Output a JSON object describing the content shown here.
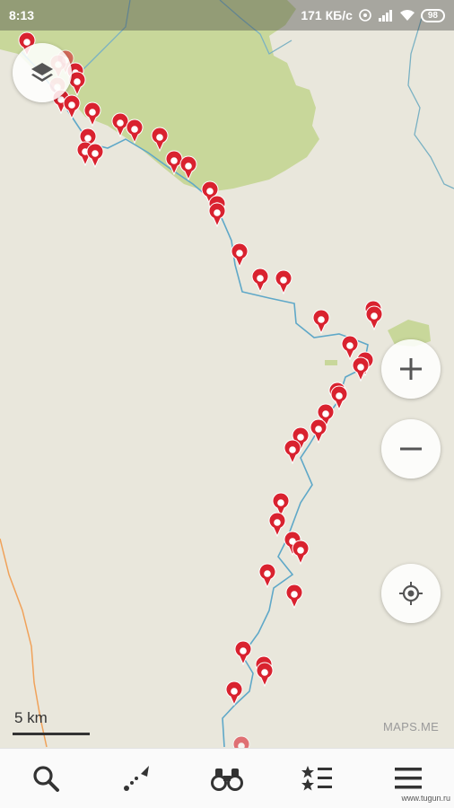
{
  "status_bar": {
    "time": "8:13",
    "network_speed": "171 КБ/с",
    "battery_level": "98",
    "icons": [
      "hotspot-icon",
      "signal-icon",
      "wifi-icon",
      "battery-icon"
    ]
  },
  "map": {
    "scale_label": "5 km",
    "brand_label": "MAPS.ME",
    "marker_color": "#d9222f",
    "route_color": "#5fa8c8",
    "forest_color": "#c8d79a",
    "background_color": "#e9e7dc"
  },
  "controls": {
    "layers": "layers-icon",
    "zoom_in": "plus-icon",
    "zoom_out": "minus-icon",
    "my_position": "location-target-icon"
  },
  "bottom_nav": {
    "items": [
      "search-icon",
      "route-icon",
      "discovery-binoculars-icon",
      "bookmarks-icon",
      "menu-icon"
    ]
  },
  "watermark": "www.tugun.ru"
}
